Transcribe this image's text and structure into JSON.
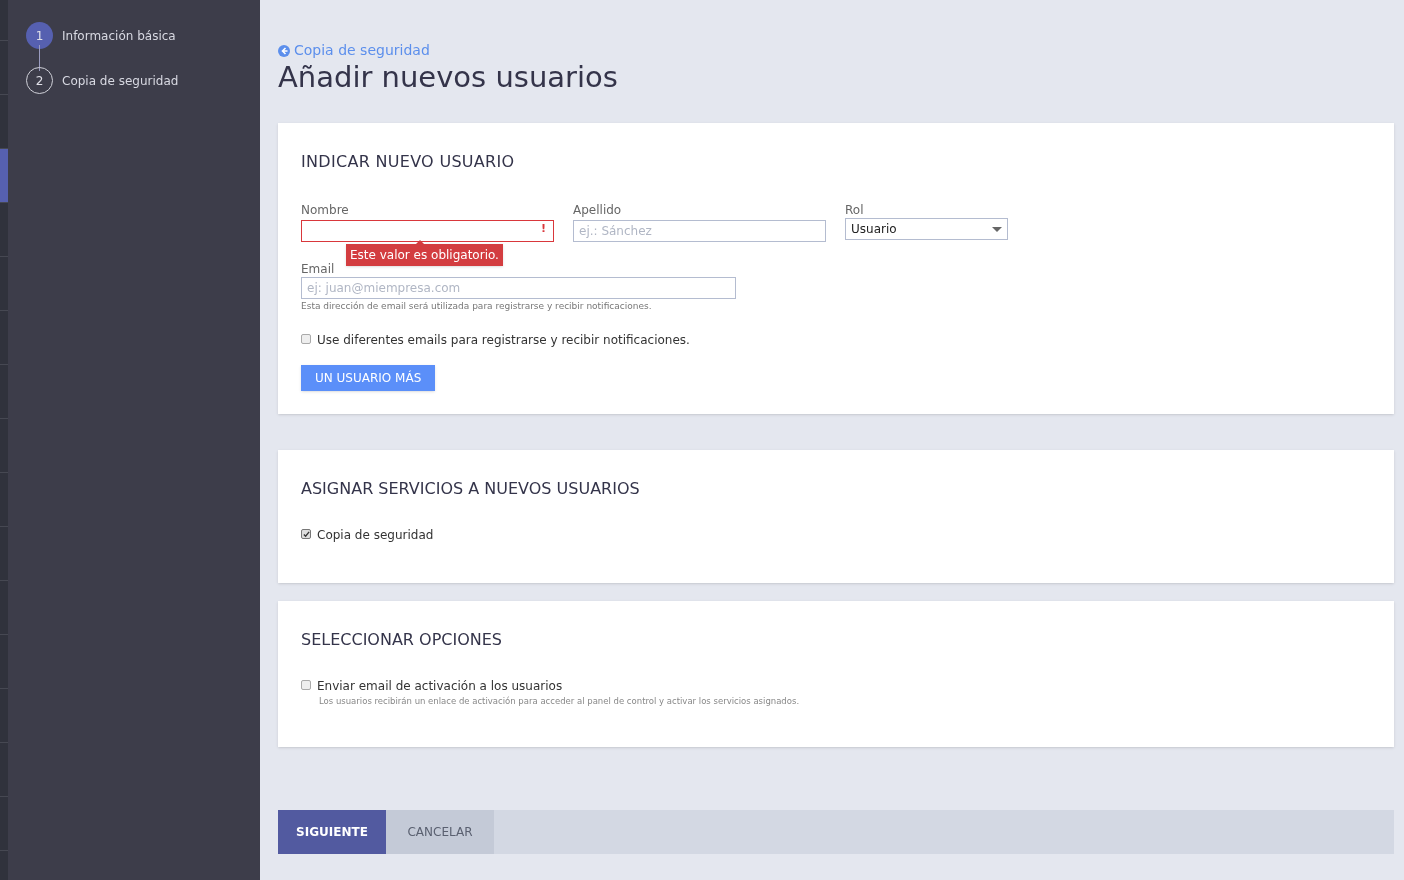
{
  "rail": [
    {
      "selected": false
    },
    {
      "selected": false
    },
    {
      "selected": false
    },
    {
      "selected": true
    },
    {
      "selected": false
    },
    {
      "selected": false
    },
    {
      "selected": false
    },
    {
      "selected": false
    },
    {
      "selected": false
    },
    {
      "selected": false
    },
    {
      "selected": false
    },
    {
      "selected": false
    },
    {
      "selected": false
    },
    {
      "selected": false
    },
    {
      "selected": false
    },
    {
      "selected": false
    }
  ],
  "steps": [
    {
      "number": "1",
      "label": "Información básica",
      "selected": true
    },
    {
      "number": "2",
      "label": "Copia de seguridad",
      "selected": false
    }
  ],
  "back_link": "Copia de seguridad",
  "title": "Añadir nuevos usuarios",
  "new_user": {
    "heading": "INDICAR NUEVO USUARIO",
    "fields": [
      {
        "label": "Nombre",
        "error_mark": "!",
        "error": "Este valor es obligatorio."
      },
      {
        "label": "Apellido",
        "placeholder": "ej.: Sánchez"
      }
    ],
    "role": {
      "label": "Rol",
      "value": "Usuario"
    },
    "email": {
      "label": "Email",
      "placeholder": "ej: juan@miempresa.com",
      "hint": "Esta dirección de email será utilizada para registrarse y recibir notificaciones."
    },
    "different_emails": {
      "label": "Use diferentes emails para registrarse y recibir notificaciones.",
      "checked": false
    },
    "add_button": "UN USUARIO MÁS"
  },
  "services": {
    "heading": "ASIGNAR SERVICIOS A NUEVOS USUARIOS",
    "items": [
      {
        "label": "Copia de seguridad",
        "checked": true
      }
    ]
  },
  "options": {
    "heading": "SELECCIONAR OPCIONES",
    "items": [
      {
        "label": "Enviar email de activación a los usuarios",
        "hint": "Los usuarios recibirán un enlace de activación para acceder al panel de control y activar los servicios asignados.",
        "checked": false
      }
    ]
  },
  "footer": {
    "next": "SIGUIENTE",
    "cancel": "CANCELAR"
  }
}
